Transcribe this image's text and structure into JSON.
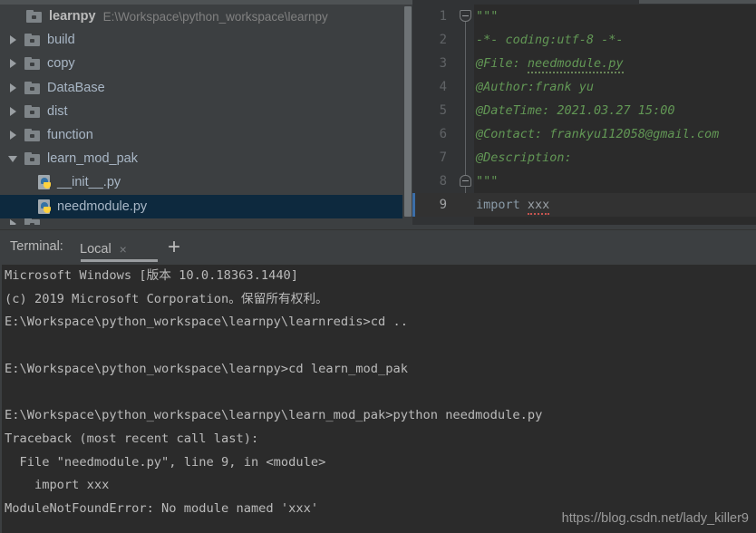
{
  "project_tree": {
    "root": {
      "name": "learnpy",
      "path": "E:\\Workspace\\python_workspace\\learnpy",
      "icon": "folder-icon"
    },
    "items": [
      {
        "label": "build",
        "icon": "folder-icon",
        "state": "collapsed",
        "indent": 1,
        "selected": false
      },
      {
        "label": "copy",
        "icon": "folder-icon",
        "state": "collapsed",
        "indent": 1,
        "selected": false
      },
      {
        "label": "DataBase",
        "icon": "folder-icon",
        "state": "collapsed",
        "indent": 1,
        "selected": false
      },
      {
        "label": "dist",
        "icon": "folder-icon",
        "state": "collapsed",
        "indent": 1,
        "selected": false
      },
      {
        "label": "function",
        "icon": "folder-icon",
        "state": "collapsed",
        "indent": 1,
        "selected": false
      },
      {
        "label": "learn_mod_pak",
        "icon": "folder-icon",
        "state": "expanded",
        "indent": 1,
        "selected": false
      },
      {
        "label": "__init__.py",
        "icon": "python-file-icon",
        "state": "leaf",
        "indent": 2,
        "selected": false
      },
      {
        "label": "needmodule.py",
        "icon": "python-file-icon",
        "state": "leaf",
        "indent": 2,
        "selected": true
      }
    ]
  },
  "editor": {
    "line_numbers": [
      "1",
      "2",
      "3",
      "4",
      "5",
      "6",
      "7",
      "8",
      "9"
    ],
    "current_line": 9,
    "lines": [
      {
        "num": "1",
        "text": "\"\"\""
      },
      {
        "num": "2",
        "text": "-*- coding:utf-8 -*-"
      },
      {
        "num": "3",
        "text": "@File: needmodule.py"
      },
      {
        "num": "4",
        "text": "@Author:frank yu"
      },
      {
        "num": "5",
        "text": "@DateTime: 2021.03.27 15:00"
      },
      {
        "num": "6",
        "text": "@Contact: frankyu112058@gmail.com"
      },
      {
        "num": "7",
        "text": "@Description:"
      },
      {
        "num": "8",
        "text": "\"\"\""
      },
      {
        "num": "9",
        "text": "import xxx"
      }
    ],
    "line9": {
      "keyword": "import",
      "identifier": "xxx"
    },
    "line3": {
      "prefix": "@File: ",
      "filename": "needmodule.py"
    }
  },
  "terminal": {
    "label": "Terminal:",
    "tab_name": "Local",
    "tab_close": "×",
    "add_tab": "+",
    "lines": [
      "Microsoft Windows [版本 10.0.18363.1440]",
      "(c) 2019 Microsoft Corporation。保留所有权利。",
      "E:\\Workspace\\python_workspace\\learnpy\\learnredis>cd ..",
      "",
      "E:\\Workspace\\python_workspace\\learnpy>cd learn_mod_pak",
      "",
      "E:\\Workspace\\python_workspace\\learnpy\\learn_mod_pak>python needmodule.py",
      "Traceback (most recent call last):",
      "  File \"needmodule.py\", line 9, in <module>",
      "    import xxx",
      "ModuleNotFoundError: No module named 'xxx'"
    ]
  },
  "watermark": "https://blog.csdn.net/lady_killer9",
  "colors": {
    "panel_bg": "#3c3f41",
    "editor_bg": "#2b2b2b",
    "gutter_bg": "#313335",
    "selection_bg": "#0d293e",
    "text": "#bbbbbb",
    "tree_text": "#a9b7c6",
    "docstring_green": "#629755",
    "error_red": "#c75450",
    "caret_row_accent": "#3b6ea8"
  }
}
